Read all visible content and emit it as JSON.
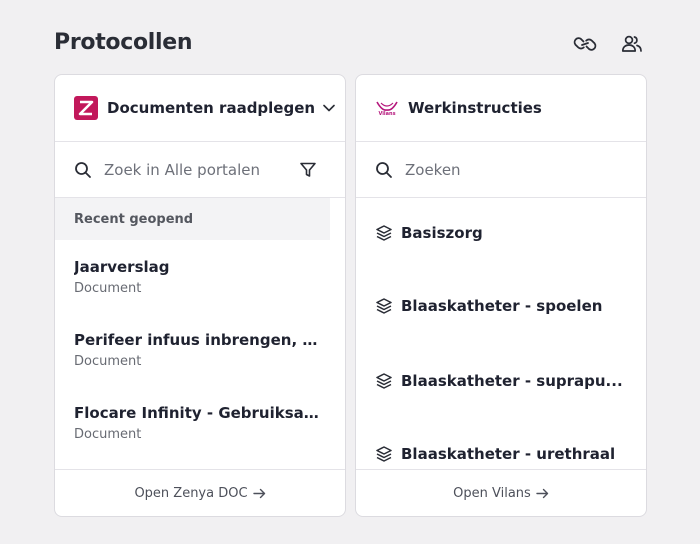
{
  "page": {
    "title": "Protocollen"
  },
  "header_icons": [
    "link-icon",
    "users-icon"
  ],
  "zenya": {
    "portal_label": "Documenten raadplegen",
    "search_placeholder": "Zoek in Alle portalen",
    "recent_heading": "Recent geopend",
    "items": [
      {
        "title": "Jaarverslag",
        "type": "Document"
      },
      {
        "title": "Perifeer infuus inbrengen, (fl...",
        "type": "Document"
      },
      {
        "title": "Flocare Infinity - Gebruiksaa...",
        "type": "Document"
      }
    ],
    "footer_label": "Open Zenya DOC",
    "brand_color": "#c2185b"
  },
  "vilans": {
    "header_label": "Werkinstructies",
    "logo_text": "Vilans",
    "search_placeholder": "Zoeken",
    "items": [
      {
        "title": "Basiszorg"
      },
      {
        "title": "Blaaskatheter - spoelen"
      },
      {
        "title": "Blaaskatheter - suprapu..."
      },
      {
        "title": "Blaaskatheter - urethraal"
      }
    ],
    "footer_label": "Open Vilans",
    "brand_color": "#b5177c"
  }
}
